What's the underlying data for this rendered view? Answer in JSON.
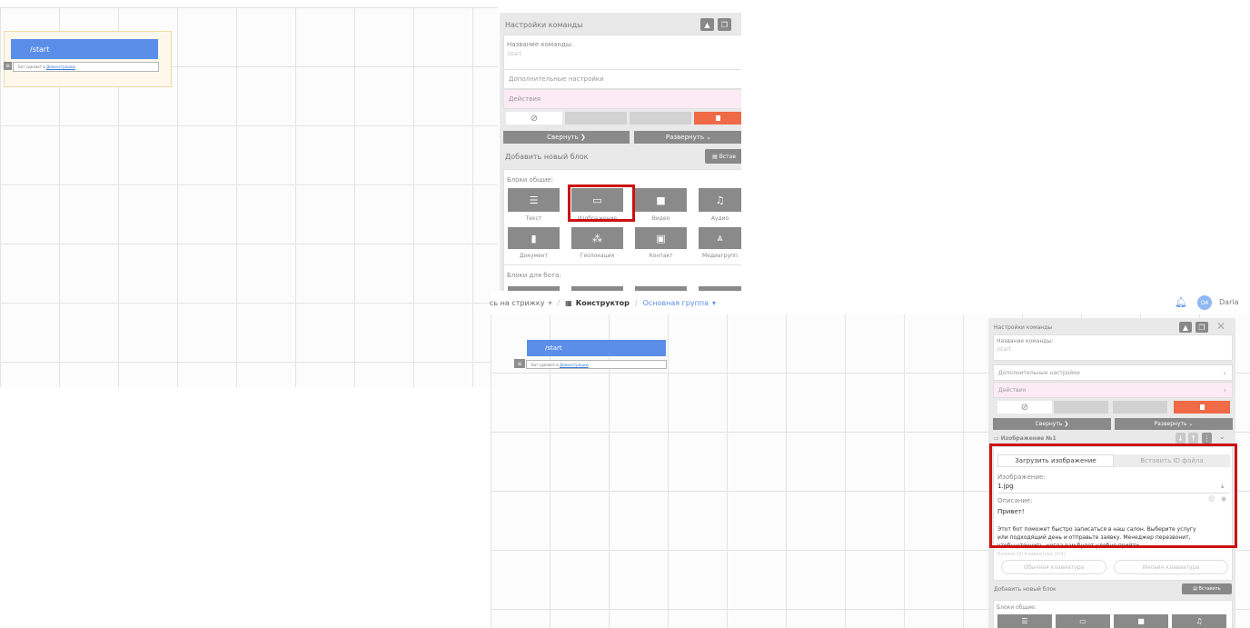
{
  "screenshot1": {
    "node": {
      "command": "/start",
      "line_prefix": "Бот сделает в",
      "line_link": "Демонстрацию"
    },
    "panel": {
      "title": "Настройки команды",
      "name_label": "Название команды:",
      "name_value": "/start",
      "extra_settings": "Дополнительные настройки",
      "actions": "Действия",
      "collapse": "Свернуть",
      "expand": "Развернуть",
      "add_block": "Добавить новый блок",
      "paste": "Встав",
      "blocks_common": "Блоки общие:",
      "tiles": [
        {
          "label": "Текст",
          "icon": "text-icon"
        },
        {
          "label": "Изображение",
          "icon": "image-icon"
        },
        {
          "label": "Видео",
          "icon": "video-icon"
        },
        {
          "label": "Аудио",
          "icon": "audio-icon"
        },
        {
          "label": "Документ",
          "icon": "document-icon"
        },
        {
          "label": "Геолокация",
          "icon": "geolocation-icon"
        },
        {
          "label": "Контакт",
          "icon": "contact-icon"
        },
        {
          "label": "Медиагрупп",
          "icon": "mediagroup-icon"
        }
      ],
      "blocks_bot": "Блоки для бота:"
    }
  },
  "screenshot2": {
    "topbar": {
      "breadcrumb1": "сь на стрижку",
      "breadcrumb2": "Конструктор",
      "breadcrumb3": "Основная группа",
      "avatar": "DA",
      "user": "Daria"
    },
    "node": {
      "command": "/start",
      "line_prefix": "Бот сделает в",
      "line_link": "Демонстрацию"
    },
    "panel": {
      "title": "Настройки команды",
      "name_label": "Название команды:",
      "name_value": "/start",
      "extra_settings": "Дополнительные настройки",
      "actions": "Действия",
      "collapse": "Свернуть",
      "expand": "Развернуть",
      "block_title": "Изображение №1",
      "tab_upload": "Загрузить изображение",
      "tab_paste": "Вставить ID файла",
      "image_label": "Изображение:",
      "image_value": "1.jpg",
      "desc_label": "Описание:",
      "desc_line1": "Привет!",
      "desc_line2": "Этот бот поможет быстро записаться в наш салон. Выберите услугу",
      "desc_line3": "или подходящий день и отправьте заявку. Менеджер перезвонит,",
      "desc_line4": "чтобы уточнить, когда вам будет удобно прийти.",
      "buttons_label": "Кнопки (0) Клавиатура (0/4)",
      "kb_normal": "Обычная клавиатура",
      "kb_inline": "Инлайн клавиатура",
      "add_block": "Добавить новый блок",
      "paste": "Вставить",
      "blocks_common": "Блоки общие:"
    }
  }
}
